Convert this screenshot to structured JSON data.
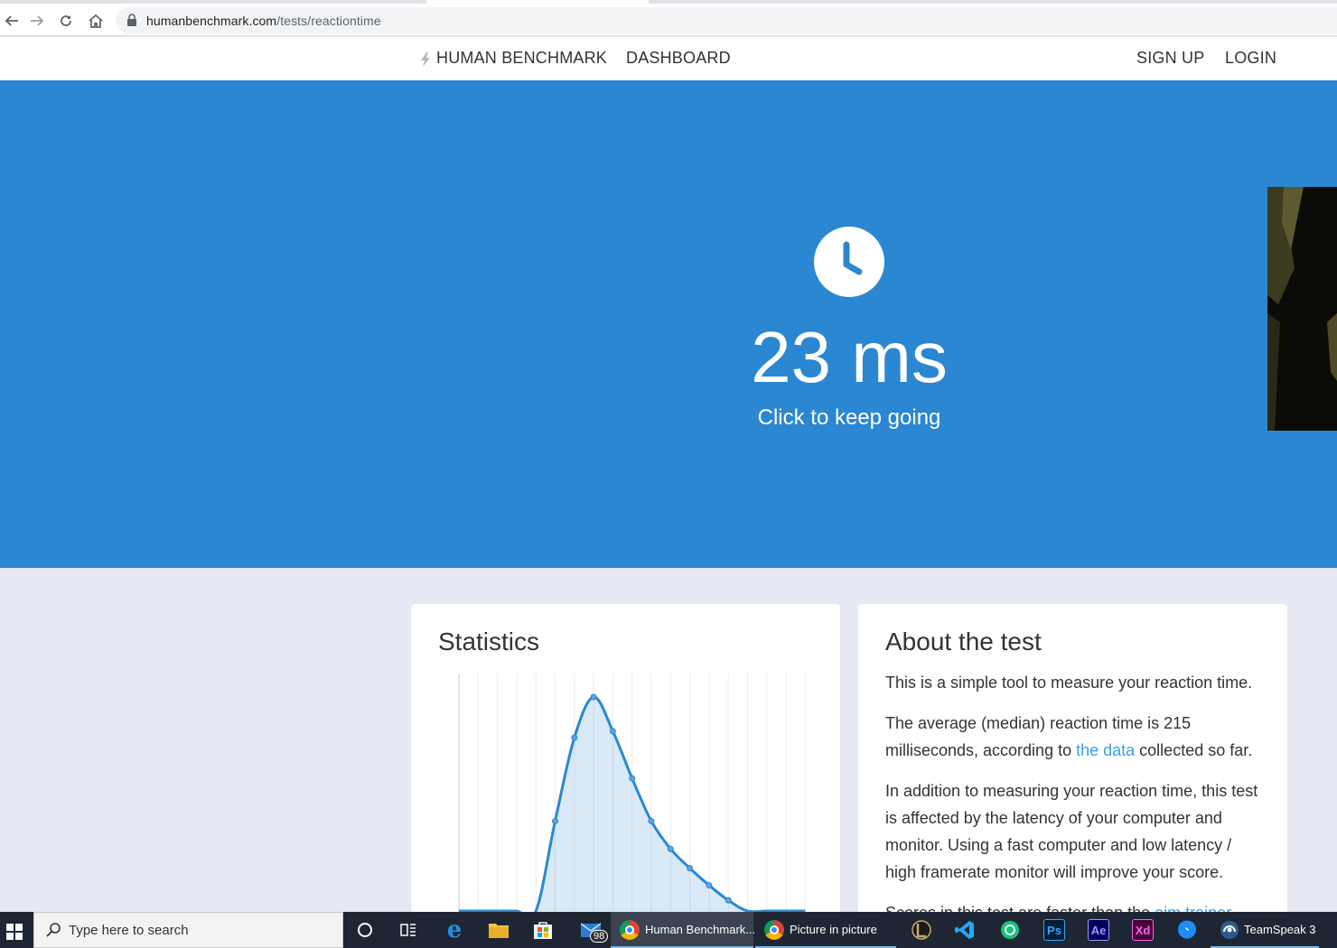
{
  "browser": {
    "url_host": "humanbenchmark.com",
    "url_path": "/tests/reactiontime"
  },
  "nav": {
    "brand": "HUMAN BENCHMARK",
    "dashboard": "DASHBOARD",
    "signup": "SIGN UP",
    "login": "LOGIN"
  },
  "hero": {
    "result": "23 ms",
    "subtitle": "Click to keep going",
    "background_color": "#2b87d1"
  },
  "stats": {
    "title": "Statistics"
  },
  "chart_data": {
    "type": "area",
    "title": "",
    "xlabel": "",
    "ylabel": "",
    "grid": true,
    "series": [
      {
        "values": [
          0,
          0,
          0,
          0,
          0,
          0.42,
          0.81,
          1.0,
          0.84,
          0.62,
          0.42,
          0.29,
          0.2,
          0.12,
          0.05,
          0,
          0,
          0,
          0
        ]
      }
    ]
  },
  "about": {
    "title": "About the test",
    "p1": "This is a simple tool to measure your reaction time.",
    "p2_a": "The average (median) reaction time is 215 milliseconds, according to ",
    "p2_link": "the data",
    "p2_b": " collected so far.",
    "p3": "In addition to measuring your reaction time, this test is affected by the latency of your computer and monitor. Using a fast computer and low latency / high framerate monitor will improve your score.",
    "p4_a": "Scores in this test are faster than the ",
    "p4_link": "aim trainer"
  },
  "taskbar": {
    "search_placeholder": "Type here to search",
    "mail_badge": "98",
    "app_human_benchmark": "Human Benchmark...",
    "app_pip": "Picture in picture",
    "app_teamspeak": "TeamSpeak 3",
    "ps": "Ps",
    "ae": "Ae",
    "xd": "Xd"
  }
}
